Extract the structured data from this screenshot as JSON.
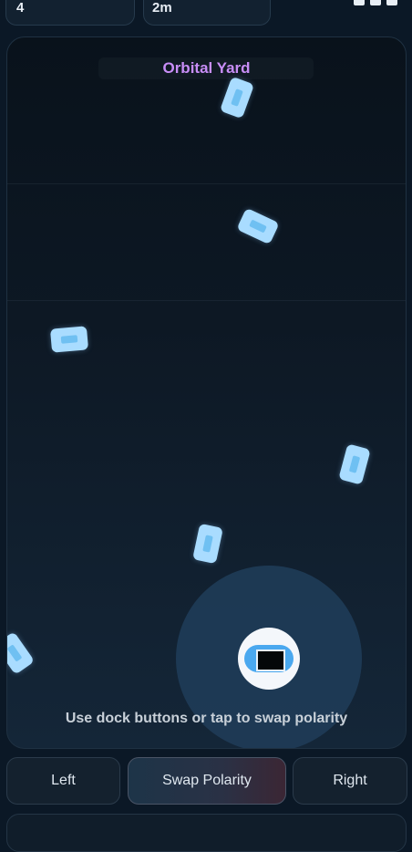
{
  "status_bar": {
    "left_text": "4",
    "center_text": "2m"
  },
  "game": {
    "title": "Orbital Yard",
    "hint": "Use dock buttons or tap to swap polarity",
    "title_color": "#c88ef7",
    "crate_color": "#a9dcff",
    "ship_color": "#4aa8ef"
  },
  "controls": {
    "left_label": "Left",
    "swap_label": "Swap Polarity",
    "right_label": "Right"
  }
}
